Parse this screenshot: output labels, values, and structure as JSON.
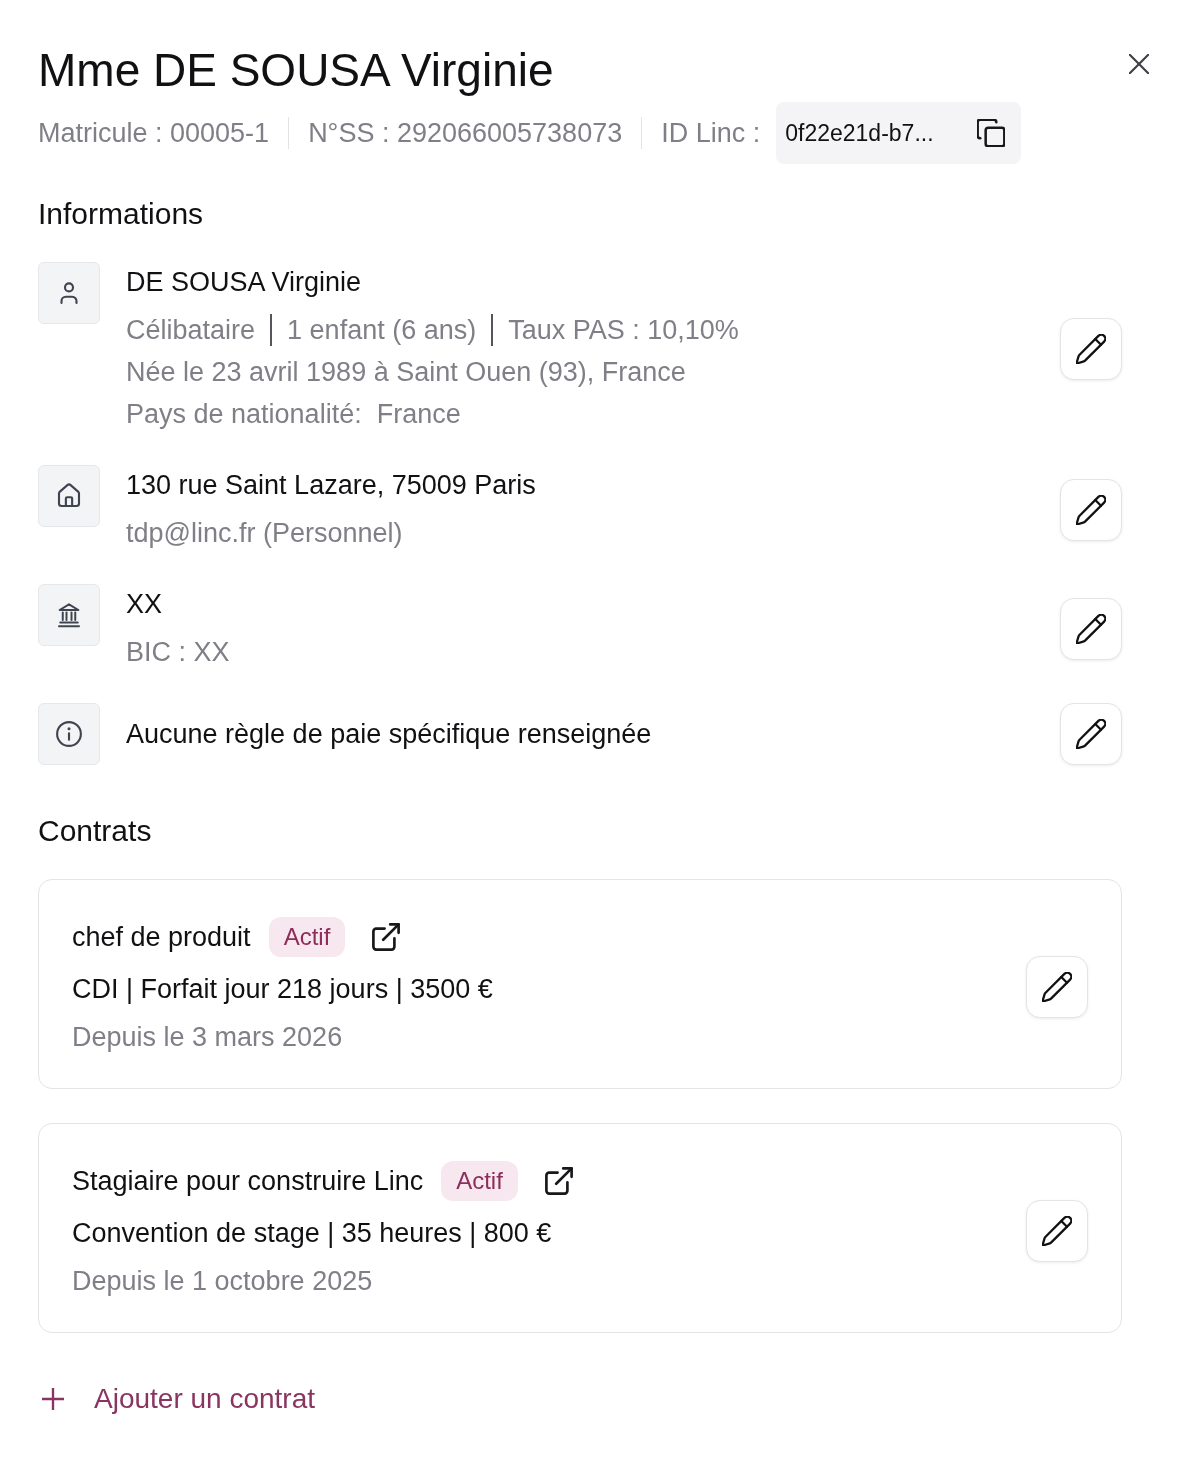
{
  "header": {
    "title": "Mme DE SOUSA Virginie",
    "meta": [
      "Matricule : 00005-1",
      "N°SS : 292066005738073"
    ],
    "id_label": "ID Linc :",
    "id_value": "0f22e21d-b7..."
  },
  "informations": {
    "heading": "Informations",
    "rows": [
      {
        "kind": "person",
        "title": "DE SOUSA Virginie",
        "facts": [
          "Célibataire",
          "1 enfant (6 ans)",
          "Taux PAS : 10,10%"
        ],
        "lines": [
          "Née le 23 avril 1989 à Saint Ouen (93), France",
          "Pays de nationalité:  France"
        ]
      },
      {
        "kind": "home",
        "title": "130 rue Saint Lazare, 75009 Paris",
        "lines": [
          "tdp@linc.fr (Personnel)"
        ]
      },
      {
        "kind": "bank",
        "title": "XX",
        "lines": [
          "BIC : XX"
        ]
      },
      {
        "kind": "info",
        "title": "Aucune règle de paie spécifique renseignée"
      }
    ]
  },
  "contracts": {
    "heading": "Contrats",
    "items": [
      {
        "title": "chef de produit",
        "status": "Actif",
        "terms": "CDI | Forfait jour 218 jours | 3500 €",
        "since": "Depuis le 3 mars 2026"
      },
      {
        "title": "Stagiaire pour construire Linc",
        "status": "Actif",
        "terms": "Convention de stage | 35 heures | 800 €",
        "since": "Depuis le 1 octobre 2025"
      }
    ],
    "add_label": "Ajouter un contrat"
  }
}
